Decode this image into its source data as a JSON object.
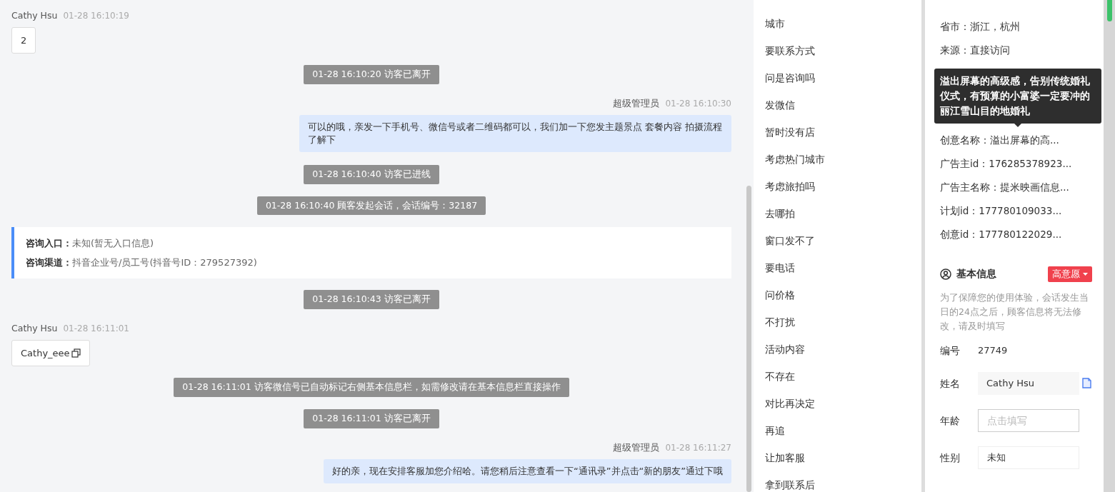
{
  "chat": {
    "messages": [
      {
        "kind": "visitor",
        "sender": "Cathy Hsu",
        "time": "01-28 16:10:19",
        "text": "2",
        "copyable": false
      },
      {
        "kind": "system",
        "text": "01-28 16:10:20 访客已离开"
      },
      {
        "kind": "agent",
        "sender": "超级管理员",
        "time": "01-28 16:10:30",
        "text": "可以的哦，亲发一下手机号、微信号或者二维码都可以，我们加一下您发主题景点 套餐内容 拍摄流程了解下"
      },
      {
        "kind": "system",
        "text": "01-28 16:10:40 访客已进线"
      },
      {
        "kind": "system",
        "text": "01-28 16:10:40 顾客发起会话，会话编号：32187"
      },
      {
        "kind": "info",
        "lines": [
          {
            "label": "咨询入口：",
            "value": "未知(暂无入口信息)"
          },
          {
            "label": "咨询渠道：",
            "value": "抖音企业号/员工号(抖音号ID：279527392)"
          }
        ]
      },
      {
        "kind": "system",
        "text": "01-28 16:10:43 访客已离开"
      },
      {
        "kind": "visitor",
        "sender": "Cathy Hsu",
        "time": "01-28 16:11:01",
        "text": "Cathy_eee",
        "copyable": true
      },
      {
        "kind": "system",
        "text": "01-28 16:11:01 访客微信号已自动标记右侧基本信息栏，如需修改请在基本信息栏直接操作"
      },
      {
        "kind": "system",
        "text": "01-28 16:11:01 访客已离开"
      },
      {
        "kind": "agent",
        "sender": "超级管理员",
        "time": "01-28 16:11:27",
        "text": "好的亲，现在安排客服加您介绍哈。请您稍后注意查看一下“通讯录”并点击“新的朋友”通过下哦"
      }
    ]
  },
  "quick_replies": [
    "城市",
    "要联系方式",
    "问是咨询吗",
    "发微信",
    "暂时没有店",
    "考虑热门城市",
    "考虑旅拍吗",
    "去哪拍",
    "窗口发不了",
    "要电话",
    "问价格",
    "不打扰",
    "活动内容",
    "不存在",
    "对比再决定",
    "再追",
    "让加客服",
    "拿到联系后"
  ],
  "info_panel": {
    "attributes": [
      "省市：浙江，杭州",
      "来源：直接访问"
    ],
    "attributes_below_tooltip": [
      "创意名称：溢出屏幕的高...",
      "广告主id：176285378923...",
      "广告主名称：提米映画信息...",
      "计划id：177780109033...",
      "创意id：177780122029..."
    ],
    "tooltip": "溢出屏幕的高级感，告别传统婚礼仪式，有预算的小富婆一定要冲的丽江雪山目的地婚礼",
    "basic_info": {
      "title": "基本信息",
      "intent_tag": "高意愿",
      "notice": "为了保障您的使用体验，会话发生当日的24点之后，顾客信息将无法修改，请及时填写",
      "fields": [
        {
          "label": "编号",
          "kind": "text",
          "value": "27749"
        },
        {
          "label": "姓名",
          "kind": "readonly",
          "value": "Cathy Hsu",
          "copyable": true
        },
        {
          "label": "年龄",
          "kind": "input",
          "placeholder": "点击填写"
        },
        {
          "label": "性别",
          "kind": "select",
          "value": "未知"
        }
      ]
    }
  }
}
